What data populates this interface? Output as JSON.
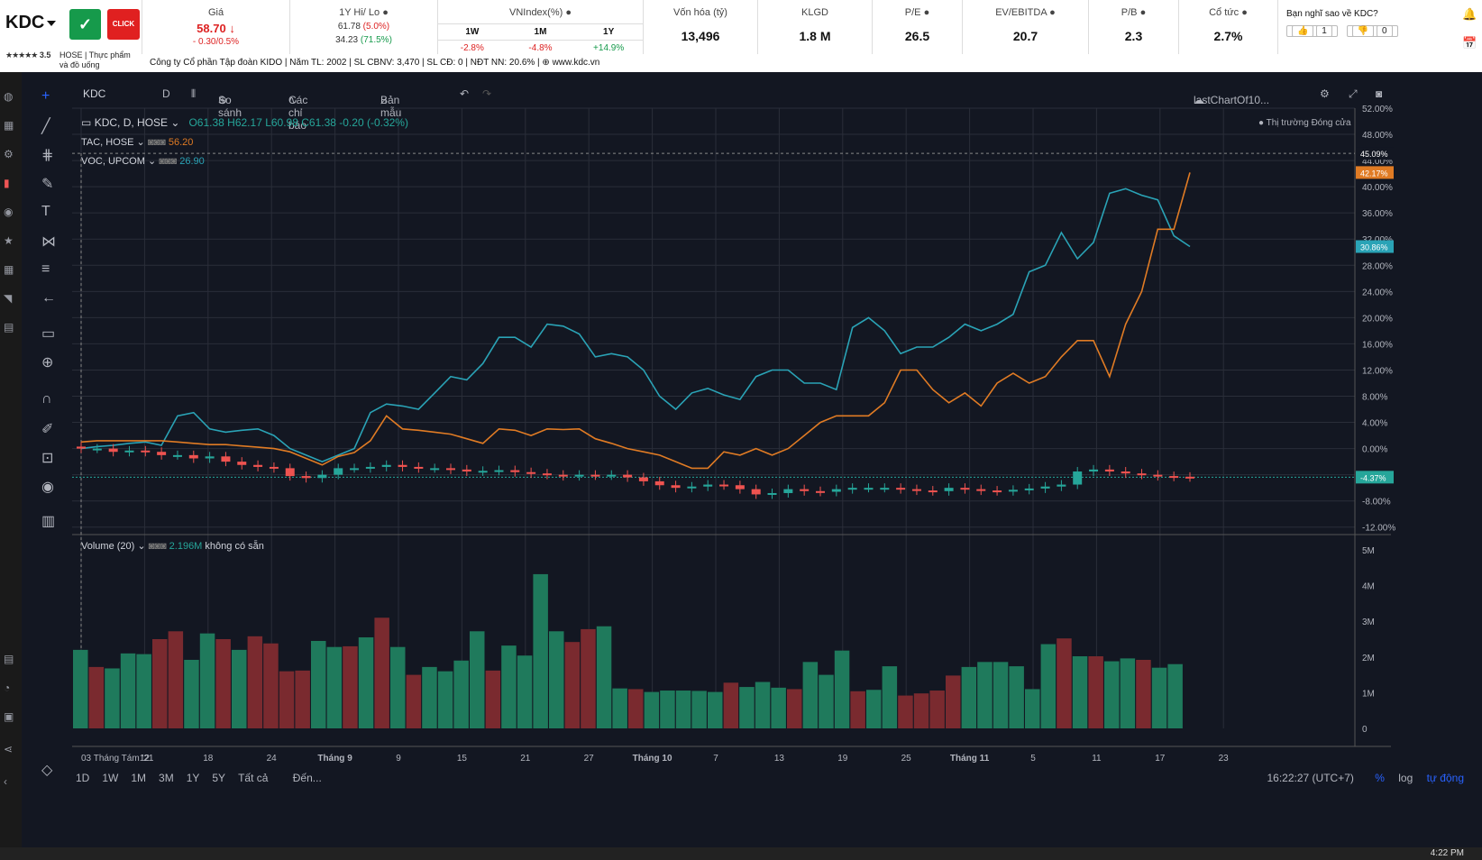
{
  "header": {
    "ticker": "KDC",
    "badge_green": "✓",
    "badge_red": "CLICK",
    "rating_stars": "★★★★★",
    "rating_value": "3.5",
    "exchange": "HOSE | Thực phẩm",
    "sector2": "và đồ uống",
    "price_label": "Giá",
    "price": "58.70",
    "price_change": "- 0.30/0.5%",
    "hilo_label": "1Y Hi/ Lo",
    "hi": "61.78",
    "hi_pct": "(5.0%)",
    "lo": "34.23",
    "lo_pct": "(71.5%)",
    "vnindex_label": "VNIndex(%)",
    "vn_periods": [
      "1W",
      "1M",
      "1Y"
    ],
    "vn_values": [
      "-2.8%",
      "-4.8%",
      "+14.9%"
    ],
    "market_cap_label": "Vốn hóa (tỷ)",
    "market_cap": "13,496",
    "klgd_label": "KLGD",
    "klgd": "1.8 M",
    "pe_label": "P/E",
    "pe": "26.5",
    "ev_label": "EV/EBITDA",
    "ev": "20.7",
    "pb_label": "P/B",
    "pb": "2.3",
    "div_label": "Cổ tức",
    "div": "2.7%",
    "vote_label": "Bạn nghĩ sao về KDC?",
    "vote_up": "1",
    "vote_down": "0",
    "company_line": "Công ty Cổ phần Tập đoàn KIDO | Năm TL: 2002 | SL CBNV: 3,470 | SL CĐ: 0 | NĐT NN: 20.6% | ⊕ www.kdc.vn"
  },
  "toolbar": {
    "symbol": "KDC",
    "interval": "D",
    "compare": "So sánh",
    "indicators": "Các chỉ báo",
    "templates": "Bản mẫu",
    "layout_name": "lastChartOf10..."
  },
  "legend": {
    "main": "KDC, D, HOSE",
    "ohlc": "O61.38  H62.17  L60.98  C61.38  -0.20 (-0.32%)",
    "market_status": "Thị trường Đóng cửa",
    "tac": "TAC, HOSE",
    "tac_value": "56.20",
    "voc": "VOC, UPCOM",
    "voc_value": "26.90",
    "volume": "Volume (20)",
    "volume_value": "2.196M",
    "volume_na": "không có sẵn"
  },
  "bottom": {
    "ranges": [
      "1D",
      "1W",
      "1M",
      "3M",
      "1Y",
      "5Y",
      "Tất cả"
    ],
    "goto": "Đến...",
    "time": "16:22:27 (UTC+7)",
    "pct": "%",
    "log": "log",
    "auto": "tự động",
    "clock": "4:22 PM"
  },
  "colors": {
    "up": "#26a69a",
    "down": "#ef5350",
    "tac_line": "#e07b24",
    "voc_line": "#2aa3b6",
    "up_volume": "#1f7a5c",
    "down_volume": "#7a2a2f"
  },
  "chart_data": {
    "type": "line",
    "y_unit": "%",
    "y_ticks": [
      "52.00%",
      "48.00%",
      "44.00%",
      "40.00%",
      "36.00%",
      "32.00%",
      "28.00%",
      "24.00%",
      "20.00%",
      "16.00%",
      "12.00%",
      "8.00%",
      "4.00%",
      "0.00%",
      "-4.00%",
      "-8.00%",
      "-12.00%"
    ],
    "ylim": [
      -13,
      52
    ],
    "x_labels": [
      "03 Tháng Tám '21",
      "12",
      "18",
      "24",
      "Tháng 9",
      "9",
      "15",
      "21",
      "27",
      "Tháng 10",
      "7",
      "13",
      "19",
      "25",
      "Tháng 11",
      "5",
      "11",
      "17",
      "23"
    ],
    "last_labels": {
      "tac": "42.17%",
      "voc": "30.86%",
      "kdc": "-4.37%",
      "ref": "45.09%"
    },
    "series": [
      {
        "name": "VOC, UPCOM",
        "values": [
          0,
          0.3,
          0.5,
          0.8,
          1,
          0.5,
          5,
          5.5,
          3,
          2.5,
          2.8,
          3,
          2,
          0,
          -1,
          -2,
          -1,
          0,
          5.5,
          6.8,
          6.5,
          6,
          8.5,
          11,
          10.5,
          13,
          17,
          17,
          15.5,
          19,
          18.7,
          17.5,
          14,
          14.5,
          14,
          12,
          8,
          6,
          8.5,
          9.2,
          8.2,
          7.5,
          11,
          12,
          12,
          10,
          10,
          9,
          18.5,
          20,
          18,
          14.5,
          15.5,
          15.5,
          17,
          19,
          18,
          19,
          20.5,
          27,
          28,
          33,
          29,
          31.5,
          39,
          39.7,
          38.7,
          38,
          32.5,
          30.86
        ]
      },
      {
        "name": "TAC, HOSE",
        "values": [
          1,
          1.2,
          1.2,
          1.2,
          1.2,
          1.2,
          1,
          0.8,
          0.6,
          0.6,
          0.4,
          0.2,
          0,
          -0.5,
          -1.5,
          -2.5,
          -1.2,
          -0.6,
          1.2,
          5,
          3,
          2.8,
          2.5,
          2.2,
          1.5,
          0.8,
          3,
          2.8,
          2,
          3,
          2.9,
          3,
          1.5,
          0.8,
          0,
          -0.5,
          -1,
          -2,
          -3,
          -3,
          -0.5,
          -1,
          0,
          -1,
          0,
          2,
          4,
          5,
          5,
          5,
          7,
          12,
          12,
          9,
          7,
          8.5,
          6.5,
          10,
          11.5,
          10,
          11,
          14,
          16.5,
          16.5,
          11,
          19,
          24,
          33.5,
          33.5,
          42.17
        ]
      },
      {
        "name": "KDC, HOSE",
        "values": [
          0,
          0,
          -0.5,
          -0.3,
          -0.5,
          -1,
          -1,
          -1.5,
          -1.2,
          -2,
          -2.5,
          -2.8,
          -3,
          -4.2,
          -4.5,
          -4,
          -3,
          -3,
          -2.8,
          -2.5,
          -2.8,
          -3,
          -3,
          -3.2,
          -3.5,
          -3.4,
          -3.3,
          -3.6,
          -3.8,
          -4,
          -4.2,
          -4,
          -4.1,
          -4,
          -4.4,
          -5,
          -5.6,
          -6,
          -5.8,
          -5.5,
          -5.6,
          -6.2,
          -7,
          -6.8,
          -6.2,
          -6.5,
          -6.6,
          -6.2,
          -6,
          -6,
          -6,
          -6.2,
          -6.4,
          -6.5,
          -6,
          -6.2,
          -6.4,
          -6.5,
          -6.3,
          -6.1,
          -5.8,
          -5.5,
          -3.5,
          -3.2,
          -3.5,
          -3.8,
          -4,
          -4.2,
          -4.3,
          -4.37
        ]
      }
    ],
    "volume": {
      "y_ticks": [
        "5M",
        "4M",
        "3M",
        "2M",
        "1M",
        "0"
      ],
      "values": [
        2.2,
        1.72,
        1.68,
        2.1,
        2.08,
        2.5,
        2.72,
        1.92,
        2.66,
        2.5,
        2.2,
        2.58,
        2.38,
        1.6,
        1.62,
        2.45,
        2.28,
        2.3,
        2.55,
        3.1,
        2.28,
        1.5,
        1.72,
        1.6,
        1.9,
        2.72,
        1.62,
        2.32,
        2.04,
        4.32,
        2.72,
        2.42,
        2.78,
        2.86,
        1.12,
        1.1,
        1.02,
        1.06,
        1.06,
        1.05,
        1.02,
        1.28,
        1.16,
        1.3,
        1.14,
        1.1,
        1.86,
        1.5,
        2.18,
        1.04,
        1.08,
        1.74,
        0.92,
        0.98,
        1.06,
        1.48,
        1.72,
        1.86,
        1.86,
        1.74,
        1.1,
        2.36,
        2.52,
        2.02,
        2.02,
        1.88,
        1.96,
        1.92,
        1.7,
        1.8
      ],
      "up": [
        1,
        0,
        1,
        1,
        1,
        0,
        0,
        1,
        1,
        0,
        1,
        0,
        0,
        0,
        0,
        1,
        1,
        0,
        1,
        0,
        1,
        0,
        1,
        1,
        1,
        1,
        0,
        1,
        1,
        1,
        1,
        0,
        0,
        1,
        1,
        0,
        1,
        1,
        1,
        1,
        1,
        0,
        1,
        1,
        1,
        0,
        1,
        1,
        1,
        0,
        1,
        1,
        0,
        0,
        0,
        0,
        1,
        1,
        1,
        1,
        1,
        1,
        0,
        1,
        0,
        1,
        1,
        0,
        1,
        1
      ]
    }
  }
}
